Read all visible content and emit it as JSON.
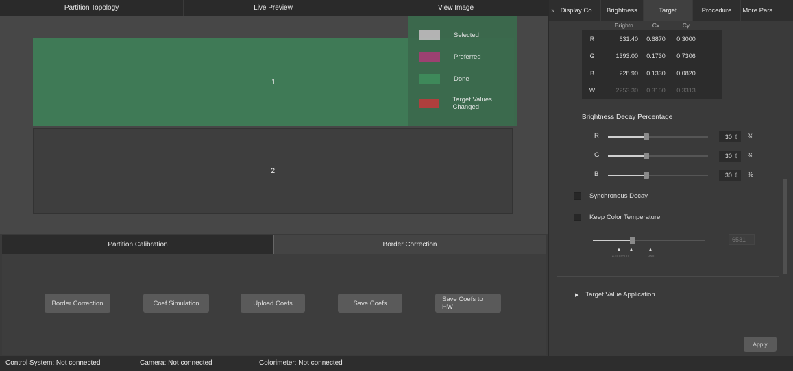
{
  "top_tabs": [
    "Partition Topology",
    "Live Preview",
    "View Image"
  ],
  "zones": {
    "zone1": "1",
    "zone2": "2"
  },
  "legend": [
    {
      "label": "Selected",
      "color": "#b9b9b9"
    },
    {
      "label": "Preferred",
      "color": "#a13f73"
    },
    {
      "label": "Done",
      "color": "#3e8a5b"
    },
    {
      "label": "Target Values Changed",
      "color": "#b53c3c"
    }
  ],
  "bottom_tabs": [
    "Partition Calibration",
    "Border Correction"
  ],
  "actions": [
    "Border Correction",
    "Coef Simulation",
    "Upload Coefs",
    "Save Coefs",
    "Save Coefs to HW"
  ],
  "status": {
    "control_system": "Control System:  Not connected",
    "camera": "Camera:  Not connected",
    "colorimeter": "Colorimeter:  Not connected"
  },
  "right_panel": {
    "scroll_arrow": "»",
    "tabs": [
      "Display Co...",
      "Brightness",
      "Target",
      "Procedure",
      "More Para..."
    ],
    "table": {
      "headers": [
        "",
        "Brightn...",
        "Cx",
        "Cy"
      ],
      "rows": [
        [
          "R",
          "631.40",
          "0.6870",
          "0.3000"
        ],
        [
          "G",
          "1393.00",
          "0.1730",
          "0.7306"
        ],
        [
          "B",
          "228.90",
          "0.1330",
          "0.0820"
        ],
        [
          "W",
          "2253.30",
          "0.3150",
          "0.3313"
        ]
      ]
    },
    "decay_title": "Brightness Decay Percentage",
    "decay": [
      {
        "name": "R",
        "value": "30",
        "level": 0.38
      },
      {
        "name": "G",
        "value": "30",
        "level": 0.38
      },
      {
        "name": "B",
        "value": "30",
        "level": 0.38
      }
    ],
    "spin_arrows": "⇕",
    "percent": "%",
    "sync_decay": "Synchronous Decay",
    "keep_temp": "Keep Color Temperature",
    "temp_value": "6531",
    "temp_marks": [
      "▲",
      "▲",
      "▲"
    ],
    "temp_mark_subs": [
      "4700 6500",
      "9300"
    ],
    "target_app": "Target Value Application",
    "apply": "Apply"
  }
}
